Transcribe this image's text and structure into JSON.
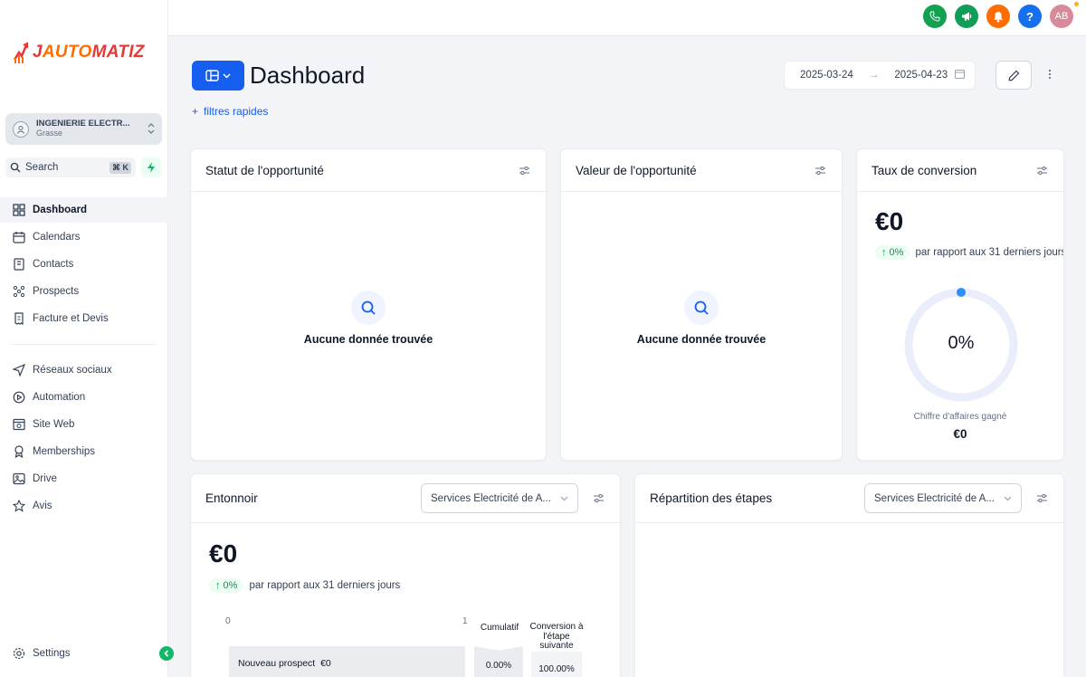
{
  "brand": {
    "logo_j": "J",
    "logo_auto": "AUTO",
    "logo_matiz": "MATIZ"
  },
  "account": {
    "name": "INGENIERIE ELECTR...",
    "location": "Grasse"
  },
  "search": {
    "label": "Search",
    "shortcut": "⌘ K"
  },
  "sidebar": {
    "primary": [
      {
        "label": "Dashboard",
        "icon": "dashboard-icon",
        "active": true
      },
      {
        "label": "Calendars",
        "icon": "calendar-icon"
      },
      {
        "label": "Contacts",
        "icon": "contacts-icon"
      },
      {
        "label": "Prospects",
        "icon": "prospects-icon"
      },
      {
        "label": "Facture et Devis",
        "icon": "invoice-icon"
      }
    ],
    "secondary": [
      {
        "label": "Réseaux sociaux",
        "icon": "send-icon"
      },
      {
        "label": "Automation",
        "icon": "automation-icon"
      },
      {
        "label": "Site Web",
        "icon": "website-icon"
      },
      {
        "label": "Memberships",
        "icon": "memberships-icon"
      },
      {
        "label": "Drive",
        "icon": "drive-icon"
      },
      {
        "label": "Avis",
        "icon": "star-icon"
      }
    ],
    "settings": "Settings"
  },
  "topbar": {
    "avatar_initials": "AB",
    "colors": {
      "phone": "#12a150",
      "announce": "#0f9d58",
      "bell": "#ff6d00",
      "help": "#1570ef",
      "avatar": "#d98a9a"
    }
  },
  "header": {
    "title": "Dashboard",
    "quick_filters": "filtres rapides",
    "date_start": "2025-03-24",
    "date_end": "2025-04-23"
  },
  "cards": {
    "opportunity_status": {
      "title": "Statut de l'opportunité",
      "empty": "Aucune donnée trouvée"
    },
    "opportunity_value": {
      "title": "Valeur de l'opportunité",
      "empty": "Aucune donnée trouvée"
    },
    "conversion_rate": {
      "title": "Taux de conversion",
      "value": "€0",
      "trend_badge": "↑ 0%",
      "trend_text": "par rapport aux 31 derniers jours",
      "gauge_percent": "0%",
      "gauge_fraction": 0,
      "won_label": "Chiffre d'affaires gagné",
      "won_value": "€0"
    },
    "funnel": {
      "title": "Entonnoir",
      "pipeline": "Services Electricité de A...",
      "value": "€0",
      "trend_badge": "↑ 0%",
      "trend_text": "par rapport aux 31 derniers jours",
      "axis_min": "0",
      "axis_max": "1",
      "col_cumulative": "Cumulatif",
      "col_conversion": "Conversion à l'étape suivante",
      "row_label": "Nouveau prospect",
      "row_value": "€0",
      "row_cumulative": "0.00%",
      "row_conversion": "100.00%"
    },
    "stage_distribution": {
      "title": "Répartition des étapes",
      "pipeline": "Services Electricité de A..."
    }
  }
}
